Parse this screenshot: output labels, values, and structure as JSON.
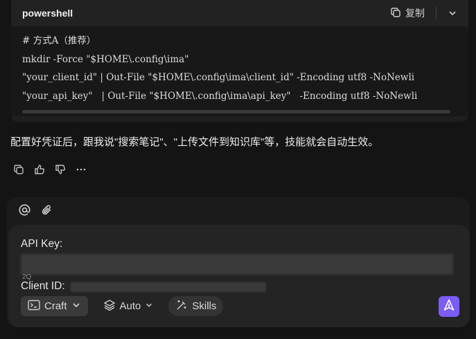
{
  "code_block": {
    "language": "powershell",
    "copy_label": "复制",
    "lines": [
      "# 方式A（推荐）",
      "mkdir -Force \"$HOME\\.config\\ima\"",
      "\"your_client_id\" | Out-File \"$HOME\\.config\\ima\\client_id\" -Encoding utf8 -NoNewli",
      "\"your_api_key\"   | Out-File \"$HOME\\.config\\ima\\api_key\"   -Encoding utf8 -NoNewli"
    ]
  },
  "message": {
    "text": "配置好凭证后，跟我说\"搜索笔记\"、\"上传文件到知识库\"等，技能就会自动生效。"
  },
  "composer": {
    "api_key_label": "API Key:",
    "partial_text": "2Q",
    "client_id_label": "Client ID:",
    "toolbar": {
      "craft_label": "Craft",
      "auto_label": "Auto",
      "skills_label": "Skills"
    }
  },
  "colors": {
    "background": "#141414",
    "send_button": "#7b5cf5"
  }
}
